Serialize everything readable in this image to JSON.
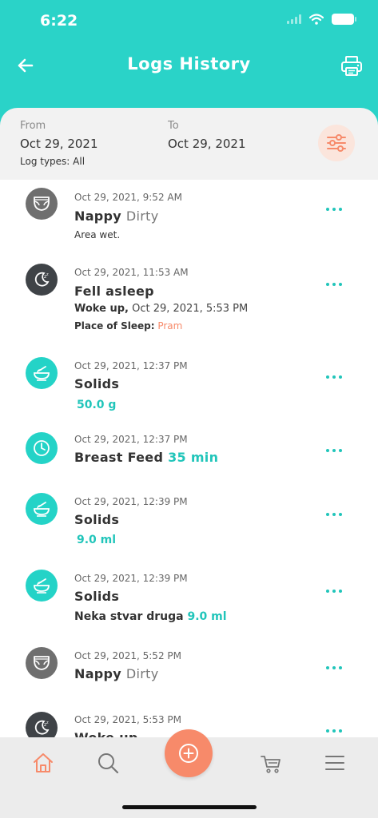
{
  "status": {
    "time": "6:22"
  },
  "header": {
    "title": "Logs History"
  },
  "filter": {
    "from_label": "From",
    "from_value": "Oct 29, 2021",
    "to_label": "To",
    "to_value": "Oct 29, 2021",
    "types_label": "Log types: All"
  },
  "logs": [
    {
      "time": "Oct 29, 2021, 9:52 AM",
      "title": "Nappy",
      "subtitle": "Dirty",
      "note": "Area wet.",
      "icon": "nappy-icon"
    },
    {
      "time": "Oct 29, 2021, 11:53 AM",
      "title": "Fell asleep",
      "woke_label": "Woke up,",
      "woke_value": "Oct 29, 2021, 5:53 PM",
      "place_label": "Place of Sleep:",
      "place_value": "Pram",
      "icon": "moon-icon"
    },
    {
      "time": "Oct 29, 2021, 12:37 PM",
      "title": "Solids",
      "amount": "50.0 g",
      "icon": "bowl-icon"
    },
    {
      "time": "Oct 29, 2021, 12:37 PM",
      "title": "Breast Feed",
      "duration": "35 min",
      "icon": "clock-icon"
    },
    {
      "time": "Oct 29, 2021, 12:39 PM",
      "title": "Solids",
      "amount": "9.0 ml",
      "icon": "bowl-icon"
    },
    {
      "time": "Oct 29, 2021, 12:39 PM",
      "title": "Solids",
      "note_text": "Neka stvar druga",
      "note_amount": "9.0 ml",
      "icon": "bowl-icon"
    },
    {
      "time": "Oct 29, 2021, 5:52 PM",
      "title": "Nappy",
      "subtitle": "Dirty",
      "icon": "nappy-icon"
    },
    {
      "time": "Oct 29, 2021, 5:53 PM",
      "title": "Woke up",
      "icon": "moon-icon"
    }
  ],
  "colors": {
    "primary": "#2ad3c8",
    "accent": "#f78a6a",
    "text": "#333333"
  },
  "nav": {
    "items": [
      "home-icon",
      "search-icon",
      "add-icon",
      "cart-icon",
      "menu-icon"
    ]
  }
}
